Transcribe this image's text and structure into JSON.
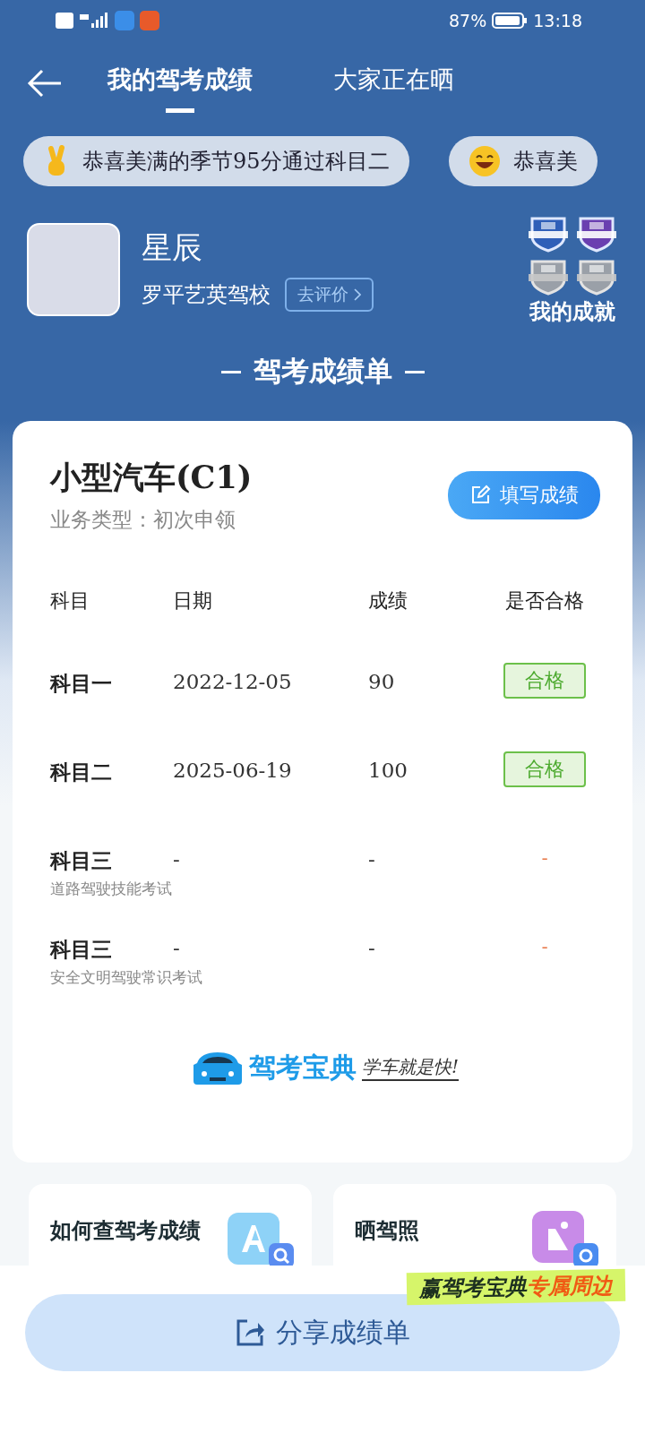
{
  "status_bar": {
    "battery": "87%",
    "time": "13:18"
  },
  "nav": {
    "tabs": [
      {
        "label": "我的驾考成绩",
        "selected": true
      },
      {
        "label": "大家正在晒",
        "selected": false
      }
    ]
  },
  "ticker": [
    {
      "kind": "hand",
      "text": "恭喜美满的季节95分通过科目二"
    },
    {
      "kind": "smile",
      "text": "恭喜美"
    }
  ],
  "profile": {
    "name": "星辰",
    "school": "罗平艺英驾校",
    "review_button": "去评价",
    "achievements_label": "我的成就",
    "badges": [
      {
        "earned": true,
        "color": "#2f5fb8"
      },
      {
        "earned": true,
        "color": "#6a3fb0"
      },
      {
        "earned": false,
        "color": "#9aa0a8"
      },
      {
        "earned": false,
        "color": "#9aa0a8"
      }
    ]
  },
  "section_title": "驾考成绩单",
  "card": {
    "license": "小型汽车(C1)",
    "business_type": "业务类型：初次申领",
    "fill_button": "填写成绩",
    "columns": [
      "科目",
      "日期",
      "成绩",
      "是否合格"
    ],
    "rows": [
      {
        "subject": "科目一",
        "date": "2022-12-05",
        "score": "90",
        "result": "合格",
        "passed": true
      },
      {
        "subject": "科目二",
        "date": "2025-06-19",
        "score": "100",
        "result": "合格",
        "passed": true
      },
      {
        "subject": "科目三",
        "subtitle": "道路驾驶技能考试",
        "date": "-",
        "score": "-",
        "result": "-",
        "passed": false
      },
      {
        "subject": "科目三",
        "subtitle": "安全文明驾驶常识考试",
        "date": "-",
        "score": "-",
        "result": "-",
        "passed": false
      }
    ],
    "brand": "驾考宝典",
    "slogan": "学车就是快!"
  },
  "links": [
    {
      "kind": "query",
      "label": "如何查驾考成绩"
    },
    {
      "kind": "photo",
      "label": "晒驾照"
    }
  ],
  "promo": {
    "text": "赢驾考宝典",
    "highlight": "专属周边"
  },
  "share_button": "分享成绩单"
}
